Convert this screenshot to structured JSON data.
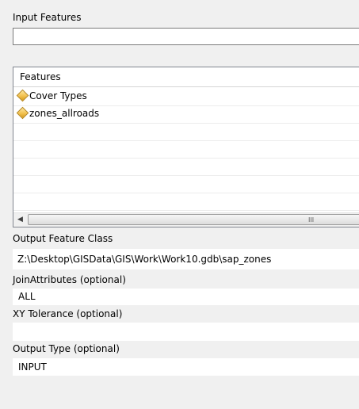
{
  "input_features": {
    "label": "Input Features",
    "value": ""
  },
  "features_list": {
    "header": "Features",
    "items": [
      {
        "label": "Cover Types",
        "icon": "feature-layer-diamond-icon"
      },
      {
        "label": "zones_allroads",
        "icon": "feature-layer-diamond-icon"
      }
    ],
    "scroll_left_glyph": "◀",
    "scroll_grip_glyph": "III"
  },
  "output_feature_class": {
    "label": "Output Feature Class",
    "value": "Z:\\Desktop\\GISData\\GIS\\Work\\Work10.gdb\\sap_zones"
  },
  "join_attributes": {
    "label": "JoinAttributes (optional)",
    "value": "ALL"
  },
  "xy_tolerance": {
    "label": "XY Tolerance (optional)",
    "value": ""
  },
  "output_type": {
    "label": "Output Type (optional)",
    "value": "INPUT"
  },
  "colors": {
    "background": "#f0f0f0",
    "field": "#ffffff",
    "icon_fill": "#f2c14e"
  }
}
